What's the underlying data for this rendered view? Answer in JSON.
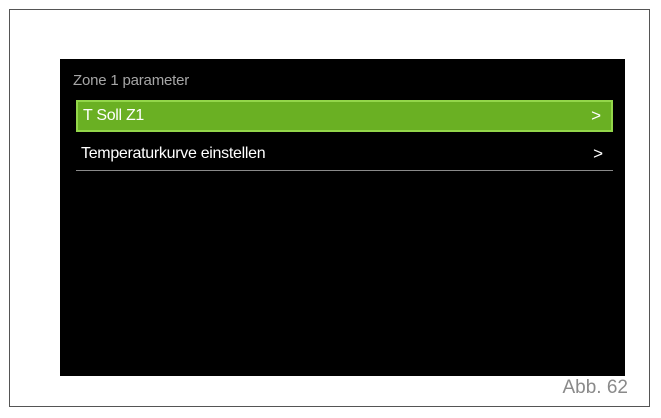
{
  "screen": {
    "title": "Zone 1 parameter",
    "menu_items": [
      {
        "label": "T Soll Z1",
        "arrow": ">",
        "selected": true
      },
      {
        "label": "Temperaturkurve einstellen",
        "arrow": ">",
        "selected": false
      }
    ]
  },
  "caption": "Abb. 62",
  "colors": {
    "screen_background": "#000000",
    "selected_row": "#6ab023",
    "selected_border": "#93d64a"
  }
}
